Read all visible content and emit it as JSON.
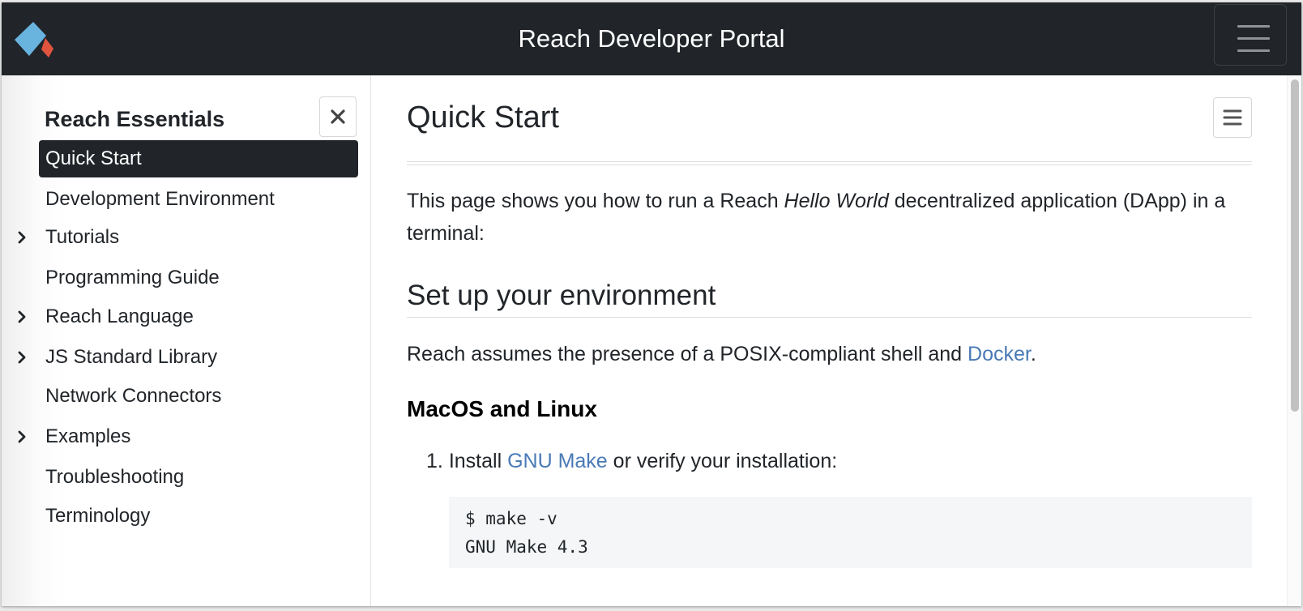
{
  "header": {
    "brand": "Reach Developer Portal",
    "logo_icon": "reach-logo-icon",
    "menu_icon": "hamburger-icon"
  },
  "sidebar": {
    "section_title": "Reach Essentials",
    "close_icon": "close-icon",
    "items": [
      {
        "label": "Quick Start",
        "active": true,
        "expandable": false
      },
      {
        "label": "Development Environment",
        "active": false,
        "expandable": false
      },
      {
        "label": "Tutorials",
        "active": false,
        "expandable": true
      },
      {
        "label": "Programming Guide",
        "active": false,
        "expandable": false
      },
      {
        "label": "Reach Language",
        "active": false,
        "expandable": true
      },
      {
        "label": "JS Standard Library",
        "active": false,
        "expandable": true
      },
      {
        "label": "Network Connectors",
        "active": false,
        "expandable": false
      },
      {
        "label": "Examples",
        "active": false,
        "expandable": true
      },
      {
        "label": "Troubleshooting",
        "active": false,
        "expandable": false
      },
      {
        "label": "Terminology",
        "active": false,
        "expandable": false
      }
    ]
  },
  "main": {
    "title": "Quick Start",
    "toc_icon": "list-icon",
    "intro": {
      "before": "This page shows you how to run a Reach ",
      "emphasis": "Hello World",
      "after": " decentralized application (DApp) in a terminal:"
    },
    "section_heading": "Set up your environment",
    "assumption": {
      "before": "Reach assumes the presence of a POSIX-compliant shell and ",
      "link": "Docker",
      "after": "."
    },
    "subheading": "MacOS and Linux",
    "step1": {
      "number": "1.",
      "before": "Install ",
      "link": "GNU Make",
      "after": " or verify your installation:"
    },
    "code_lines": [
      "$ make -v",
      "GNU Make 4.3"
    ]
  },
  "colors": {
    "navbar": "#212529",
    "active_item": "#212529",
    "link": "#4a7ab5",
    "logo_blue": "#69b3df",
    "logo_red": "#e0533e"
  }
}
